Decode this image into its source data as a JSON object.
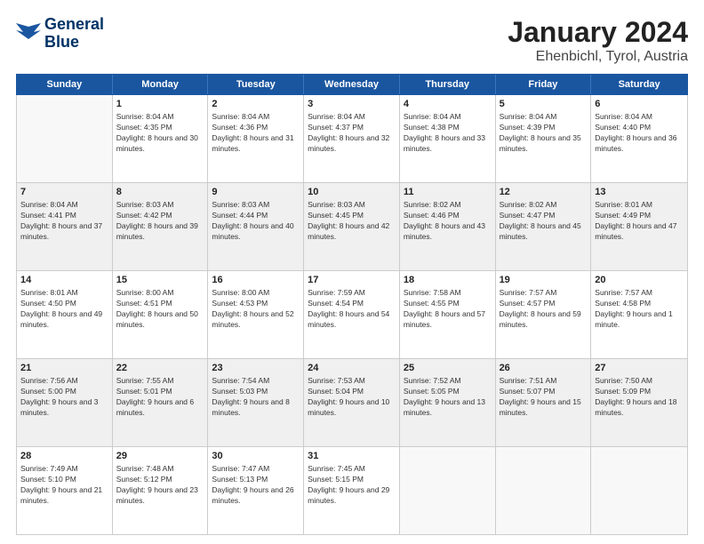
{
  "logo": {
    "line1": "General",
    "line2": "Blue"
  },
  "title": "January 2024",
  "subtitle": "Ehenbichl, Tyrol, Austria",
  "header_days": [
    "Sunday",
    "Monday",
    "Tuesday",
    "Wednesday",
    "Thursday",
    "Friday",
    "Saturday"
  ],
  "weeks": [
    [
      {
        "day": "",
        "sunrise": "",
        "sunset": "",
        "daylight": "",
        "shaded": false,
        "empty": true
      },
      {
        "day": "1",
        "sunrise": "Sunrise: 8:04 AM",
        "sunset": "Sunset: 4:35 PM",
        "daylight": "Daylight: 8 hours and 30 minutes.",
        "shaded": false,
        "empty": false
      },
      {
        "day": "2",
        "sunrise": "Sunrise: 8:04 AM",
        "sunset": "Sunset: 4:36 PM",
        "daylight": "Daylight: 8 hours and 31 minutes.",
        "shaded": false,
        "empty": false
      },
      {
        "day": "3",
        "sunrise": "Sunrise: 8:04 AM",
        "sunset": "Sunset: 4:37 PM",
        "daylight": "Daylight: 8 hours and 32 minutes.",
        "shaded": false,
        "empty": false
      },
      {
        "day": "4",
        "sunrise": "Sunrise: 8:04 AM",
        "sunset": "Sunset: 4:38 PM",
        "daylight": "Daylight: 8 hours and 33 minutes.",
        "shaded": false,
        "empty": false
      },
      {
        "day": "5",
        "sunrise": "Sunrise: 8:04 AM",
        "sunset": "Sunset: 4:39 PM",
        "daylight": "Daylight: 8 hours and 35 minutes.",
        "shaded": false,
        "empty": false
      },
      {
        "day": "6",
        "sunrise": "Sunrise: 8:04 AM",
        "sunset": "Sunset: 4:40 PM",
        "daylight": "Daylight: 8 hours and 36 minutes.",
        "shaded": false,
        "empty": false
      }
    ],
    [
      {
        "day": "7",
        "sunrise": "Sunrise: 8:04 AM",
        "sunset": "Sunset: 4:41 PM",
        "daylight": "Daylight: 8 hours and 37 minutes.",
        "shaded": true,
        "empty": false
      },
      {
        "day": "8",
        "sunrise": "Sunrise: 8:03 AM",
        "sunset": "Sunset: 4:42 PM",
        "daylight": "Daylight: 8 hours and 39 minutes.",
        "shaded": true,
        "empty": false
      },
      {
        "day": "9",
        "sunrise": "Sunrise: 8:03 AM",
        "sunset": "Sunset: 4:44 PM",
        "daylight": "Daylight: 8 hours and 40 minutes.",
        "shaded": true,
        "empty": false
      },
      {
        "day": "10",
        "sunrise": "Sunrise: 8:03 AM",
        "sunset": "Sunset: 4:45 PM",
        "daylight": "Daylight: 8 hours and 42 minutes.",
        "shaded": true,
        "empty": false
      },
      {
        "day": "11",
        "sunrise": "Sunrise: 8:02 AM",
        "sunset": "Sunset: 4:46 PM",
        "daylight": "Daylight: 8 hours and 43 minutes.",
        "shaded": true,
        "empty": false
      },
      {
        "day": "12",
        "sunrise": "Sunrise: 8:02 AM",
        "sunset": "Sunset: 4:47 PM",
        "daylight": "Daylight: 8 hours and 45 minutes.",
        "shaded": true,
        "empty": false
      },
      {
        "day": "13",
        "sunrise": "Sunrise: 8:01 AM",
        "sunset": "Sunset: 4:49 PM",
        "daylight": "Daylight: 8 hours and 47 minutes.",
        "shaded": true,
        "empty": false
      }
    ],
    [
      {
        "day": "14",
        "sunrise": "Sunrise: 8:01 AM",
        "sunset": "Sunset: 4:50 PM",
        "daylight": "Daylight: 8 hours and 49 minutes.",
        "shaded": false,
        "empty": false
      },
      {
        "day": "15",
        "sunrise": "Sunrise: 8:00 AM",
        "sunset": "Sunset: 4:51 PM",
        "daylight": "Daylight: 8 hours and 50 minutes.",
        "shaded": false,
        "empty": false
      },
      {
        "day": "16",
        "sunrise": "Sunrise: 8:00 AM",
        "sunset": "Sunset: 4:53 PM",
        "daylight": "Daylight: 8 hours and 52 minutes.",
        "shaded": false,
        "empty": false
      },
      {
        "day": "17",
        "sunrise": "Sunrise: 7:59 AM",
        "sunset": "Sunset: 4:54 PM",
        "daylight": "Daylight: 8 hours and 54 minutes.",
        "shaded": false,
        "empty": false
      },
      {
        "day": "18",
        "sunrise": "Sunrise: 7:58 AM",
        "sunset": "Sunset: 4:55 PM",
        "daylight": "Daylight: 8 hours and 57 minutes.",
        "shaded": false,
        "empty": false
      },
      {
        "day": "19",
        "sunrise": "Sunrise: 7:57 AM",
        "sunset": "Sunset: 4:57 PM",
        "daylight": "Daylight: 8 hours and 59 minutes.",
        "shaded": false,
        "empty": false
      },
      {
        "day": "20",
        "sunrise": "Sunrise: 7:57 AM",
        "sunset": "Sunset: 4:58 PM",
        "daylight": "Daylight: 9 hours and 1 minute.",
        "shaded": false,
        "empty": false
      }
    ],
    [
      {
        "day": "21",
        "sunrise": "Sunrise: 7:56 AM",
        "sunset": "Sunset: 5:00 PM",
        "daylight": "Daylight: 9 hours and 3 minutes.",
        "shaded": true,
        "empty": false
      },
      {
        "day": "22",
        "sunrise": "Sunrise: 7:55 AM",
        "sunset": "Sunset: 5:01 PM",
        "daylight": "Daylight: 9 hours and 6 minutes.",
        "shaded": true,
        "empty": false
      },
      {
        "day": "23",
        "sunrise": "Sunrise: 7:54 AM",
        "sunset": "Sunset: 5:03 PM",
        "daylight": "Daylight: 9 hours and 8 minutes.",
        "shaded": true,
        "empty": false
      },
      {
        "day": "24",
        "sunrise": "Sunrise: 7:53 AM",
        "sunset": "Sunset: 5:04 PM",
        "daylight": "Daylight: 9 hours and 10 minutes.",
        "shaded": true,
        "empty": false
      },
      {
        "day": "25",
        "sunrise": "Sunrise: 7:52 AM",
        "sunset": "Sunset: 5:05 PM",
        "daylight": "Daylight: 9 hours and 13 minutes.",
        "shaded": true,
        "empty": false
      },
      {
        "day": "26",
        "sunrise": "Sunrise: 7:51 AM",
        "sunset": "Sunset: 5:07 PM",
        "daylight": "Daylight: 9 hours and 15 minutes.",
        "shaded": true,
        "empty": false
      },
      {
        "day": "27",
        "sunrise": "Sunrise: 7:50 AM",
        "sunset": "Sunset: 5:09 PM",
        "daylight": "Daylight: 9 hours and 18 minutes.",
        "shaded": true,
        "empty": false
      }
    ],
    [
      {
        "day": "28",
        "sunrise": "Sunrise: 7:49 AM",
        "sunset": "Sunset: 5:10 PM",
        "daylight": "Daylight: 9 hours and 21 minutes.",
        "shaded": false,
        "empty": false
      },
      {
        "day": "29",
        "sunrise": "Sunrise: 7:48 AM",
        "sunset": "Sunset: 5:12 PM",
        "daylight": "Daylight: 9 hours and 23 minutes.",
        "shaded": false,
        "empty": false
      },
      {
        "day": "30",
        "sunrise": "Sunrise: 7:47 AM",
        "sunset": "Sunset: 5:13 PM",
        "daylight": "Daylight: 9 hours and 26 minutes.",
        "shaded": false,
        "empty": false
      },
      {
        "day": "31",
        "sunrise": "Sunrise: 7:45 AM",
        "sunset": "Sunset: 5:15 PM",
        "daylight": "Daylight: 9 hours and 29 minutes.",
        "shaded": false,
        "empty": false
      },
      {
        "day": "",
        "sunrise": "",
        "sunset": "",
        "daylight": "",
        "shaded": false,
        "empty": true
      },
      {
        "day": "",
        "sunrise": "",
        "sunset": "",
        "daylight": "",
        "shaded": false,
        "empty": true
      },
      {
        "day": "",
        "sunrise": "",
        "sunset": "",
        "daylight": "",
        "shaded": false,
        "empty": true
      }
    ]
  ]
}
